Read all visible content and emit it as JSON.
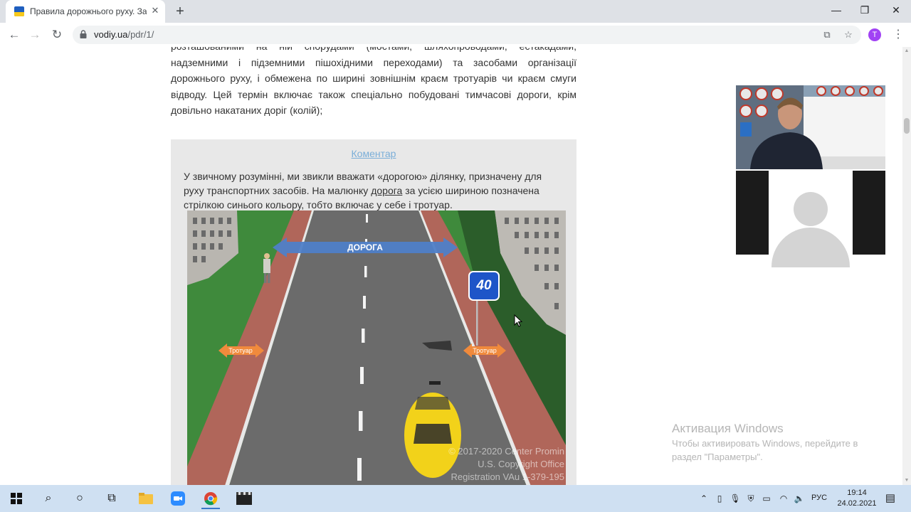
{
  "browser": {
    "tab_title": "Правила дорожнього руху. Заг",
    "tab_close": "✕",
    "new_tab": "+",
    "url_domain": "vodiy.ua",
    "url_path": "/pdr/1/",
    "profile_initial": "T",
    "window_controls": {
      "minimize": "—",
      "maximize": "❐",
      "close": "✕"
    }
  },
  "article": {
    "paragraph_lines": "розташованими на ній спорудами (мостами, шляхопроводами, естакадами, надземними і підземними пішохідними переходами) та засобами організації дорожнього руху, і обмежена по ширині зовнішнім краєм тротуарів чи краєм смуги відводу. Цей термін включає також спеціально побудовані тимчасові дороги, крім довільно накатаних доріг (колій);"
  },
  "comment": {
    "link": "Коментар",
    "text_before": "У звичному розумінні, ми звикли вважати «дорогою» ділянку, призначену для руху транспортних засобів. На малюнку ",
    "text_link": "дорога",
    "text_after": " за усією шириною позначена стрілкою синього кольору, тобто включає у себе і тротуар."
  },
  "illustration": {
    "road_label": "ДОРОГА",
    "sidewalk_left_label": "Тротуар",
    "sidewalk_right_label": "Тротуар",
    "speed_sign": "40",
    "copyright_line1": "© 2017-2020 Center Promin",
    "copyright_line2": "U.S. Copyright Office",
    "copyright_line3": "Registration VAu 1-379-195",
    "colors": {
      "road_arrow": "#4f7fc8",
      "sidewalk_arrow": "#f08a3c",
      "sign": "#1e55c8",
      "car": "#f2d21a"
    }
  },
  "activation": {
    "title": "Активация Windows",
    "line1": "Чтобы активировать Windows, перейдите в",
    "line2": "раздел \"Параметры\"."
  },
  "taskbar": {
    "language": "РУС",
    "time": "19:14",
    "date": "24.02.2021"
  }
}
